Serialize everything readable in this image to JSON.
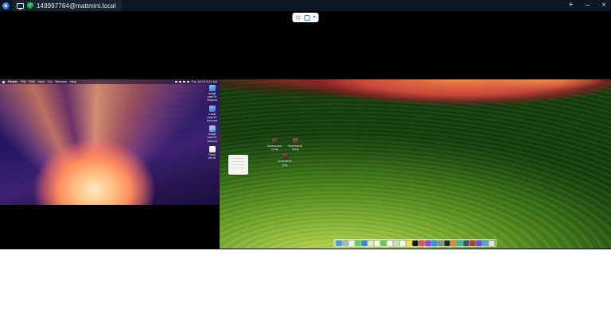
{
  "titlebar": {
    "title": "149997764@mattmini.local",
    "shield_glyph": "✓",
    "controls": {
      "new_tab": "+",
      "minimize": "–",
      "close": "×"
    }
  },
  "toolbar": {
    "chevron_glyph": "▾",
    "icons": [
      "drag-handle-icon",
      "fullscreen-icon",
      "chevron-down-icon"
    ]
  },
  "colors": {
    "titlebar_bg": "#0c1624",
    "canvas_bg": "#000000",
    "accent_blue": "#3b7bd8",
    "shield_green": "#21a84a"
  },
  "left_screen": {
    "wallpaper": "macos-sequoia-orange-aurora",
    "menu_bar": {
      "items": [
        {
          "label": "Finder"
        },
        {
          "label": "File"
        },
        {
          "label": "Edit"
        },
        {
          "label": "View"
        },
        {
          "label": "Go"
        },
        {
          "label": "Window"
        },
        {
          "label": "Help"
        }
      ],
      "status_icons": [
        {
          "icon": "control-center-icon"
        },
        {
          "icon": "wifi-icon"
        },
        {
          "icon": "search-icon"
        },
        {
          "icon": "battery-icon"
        }
      ],
      "clock": "Tue Jul 23 9:41 AM"
    },
    "desktop_icons": [
      {
        "label": "Install macOS Sequoia",
        "color": "linear-gradient(160deg,#7fd4f2,#2f7fd6)"
      },
      {
        "label": "Install macOS Sonoma",
        "color": "linear-gradient(160deg,#9fc3ef,#3d66c9)"
      },
      {
        "label": "Install macOS Ventura",
        "color": "linear-gradient(160deg,#bcd6f2,#5b87d4)"
      },
      {
        "label": "Read Me.rtf",
        "color": "linear-gradient(180deg,#ffffff,#dfe6ee)"
      }
    ]
  },
  "right_screen": {
    "wallpaper": "macos-sonoma-green-waves",
    "widget": {
      "name": "sticky-note"
    },
    "desktop_icons": [
      {
        "label": "Screenshot 2.png",
        "color": "linear-gradient(160deg,#6b5a4e,#2e2a28)"
      },
      {
        "label": "Screenshot 3.png",
        "color": "linear-gradient(160deg,#8a6a52,#3a302a)"
      },
      {
        "label": "Screenshot.png",
        "color": "linear-gradient(160deg,#7c5c48,#352c26)"
      }
    ],
    "dock": {
      "icons": [
        {
          "name": "finder",
          "color": "#3f9af2"
        },
        {
          "name": "launchpad",
          "color": "#aeb4bc"
        },
        {
          "name": "safari",
          "color": "#e9f1fa"
        },
        {
          "name": "messages",
          "color": "#58d75f"
        },
        {
          "name": "mail",
          "color": "#2f86f0"
        },
        {
          "name": "maps",
          "color": "#d9efd4"
        },
        {
          "name": "photos",
          "color": "#faf6f1"
        },
        {
          "name": "facetime",
          "color": "#57d45e"
        },
        {
          "name": "calendar",
          "color": "#f7f7f7"
        },
        {
          "name": "contacts",
          "color": "#d2d5da"
        },
        {
          "name": "reminders",
          "color": "#f5f6f8"
        },
        {
          "name": "notes",
          "color": "#f8da4e"
        },
        {
          "name": "tv",
          "color": "#171717"
        },
        {
          "name": "music",
          "color": "#f5455c"
        },
        {
          "name": "podcasts",
          "color": "#8c48ea"
        },
        {
          "name": "app-store",
          "color": "#2596f3"
        },
        {
          "name": "system-settings",
          "color": "#878d95"
        },
        {
          "name": "terminal",
          "color": "#23272e"
        },
        {
          "name": "app-orange",
          "color": "#ef8434"
        },
        {
          "name": "app-teal",
          "color": "#2fbfa8"
        },
        {
          "name": "app-dark-blue",
          "color": "#31517e"
        },
        {
          "name": "app-red",
          "color": "#c23b32"
        },
        {
          "name": "app-purple",
          "color": "#6e4de0"
        },
        {
          "name": "downloads-folder",
          "color": "#4aa3ef"
        },
        {
          "name": "trash",
          "color": "rgba(235,238,242,0.85)"
        }
      ]
    }
  }
}
